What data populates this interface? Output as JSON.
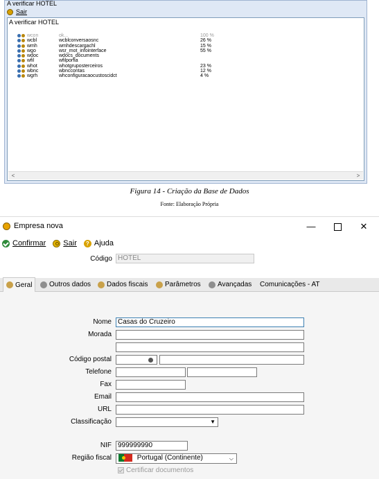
{
  "fig14": {
    "title": "A verificar HOTEL",
    "menu_exit": "Sair",
    "panel_header": "A verificar HOTEL",
    "rows": [
      {
        "code": "wcon",
        "desc": "ok...",
        "pct": "100 %",
        "faded": true
      },
      {
        "code": "wcbl",
        "desc": "wcblconversaosnc",
        "pct": "26 %",
        "faded": false
      },
      {
        "code": "wmh",
        "desc": "wmhdescargachl",
        "pct": "15 %",
        "faded": false
      },
      {
        "code": "wgo",
        "desc": "wsr_mot_infointerface",
        "pct": "55 %",
        "faded": false
      },
      {
        "code": "wdoc",
        "desc": "wdocs_documents",
        "pct": "",
        "faded": false
      },
      {
        "code": "wfil",
        "desc": "wfilporfia",
        "pct": "",
        "faded": false
      },
      {
        "code": "whot",
        "desc": "whotgruposterceiros",
        "pct": "23 %",
        "faded": false
      },
      {
        "code": "wbnc",
        "desc": "wbnccontas",
        "pct": "12 %",
        "faded": false
      },
      {
        "code": "wgrh",
        "desc": "whconfiguracaocustoscidct",
        "pct": "4 %",
        "faded": false
      }
    ],
    "scroll_left": "<",
    "scroll_right": ">"
  },
  "caption": {
    "figure": "Figura 14 - Criação da Base de Dados",
    "source": "Fonte: Elaboração Própria"
  },
  "window": {
    "title": "Empresa nova",
    "minimize": "—",
    "close": "✕",
    "toolbar": {
      "confirm": "Confirmar",
      "exit": "Sair",
      "help": "Ajuda"
    },
    "code_label": "Código",
    "code_value": "HOTEL",
    "tabs": [
      "Geral",
      "Outros dados",
      "Dados fiscais",
      "Parâmetros",
      "Avançadas",
      "Comunicações - AT"
    ],
    "form": {
      "nome_label": "Nome",
      "nome_value": "Casas do Cruzeiro",
      "morada_label": "Morada",
      "codigo_postal_label": "Código postal",
      "telefone_label": "Telefone",
      "fax_label": "Fax",
      "email_label": "Email",
      "url_label": "URL",
      "classificacao_label": "Classificação",
      "nif_label": "NIF",
      "nif_value": "999999990",
      "regiao_label": "Região fiscal",
      "regiao_value": "Portugal (Continente)",
      "certificar_label": "Certificar documentos"
    }
  }
}
